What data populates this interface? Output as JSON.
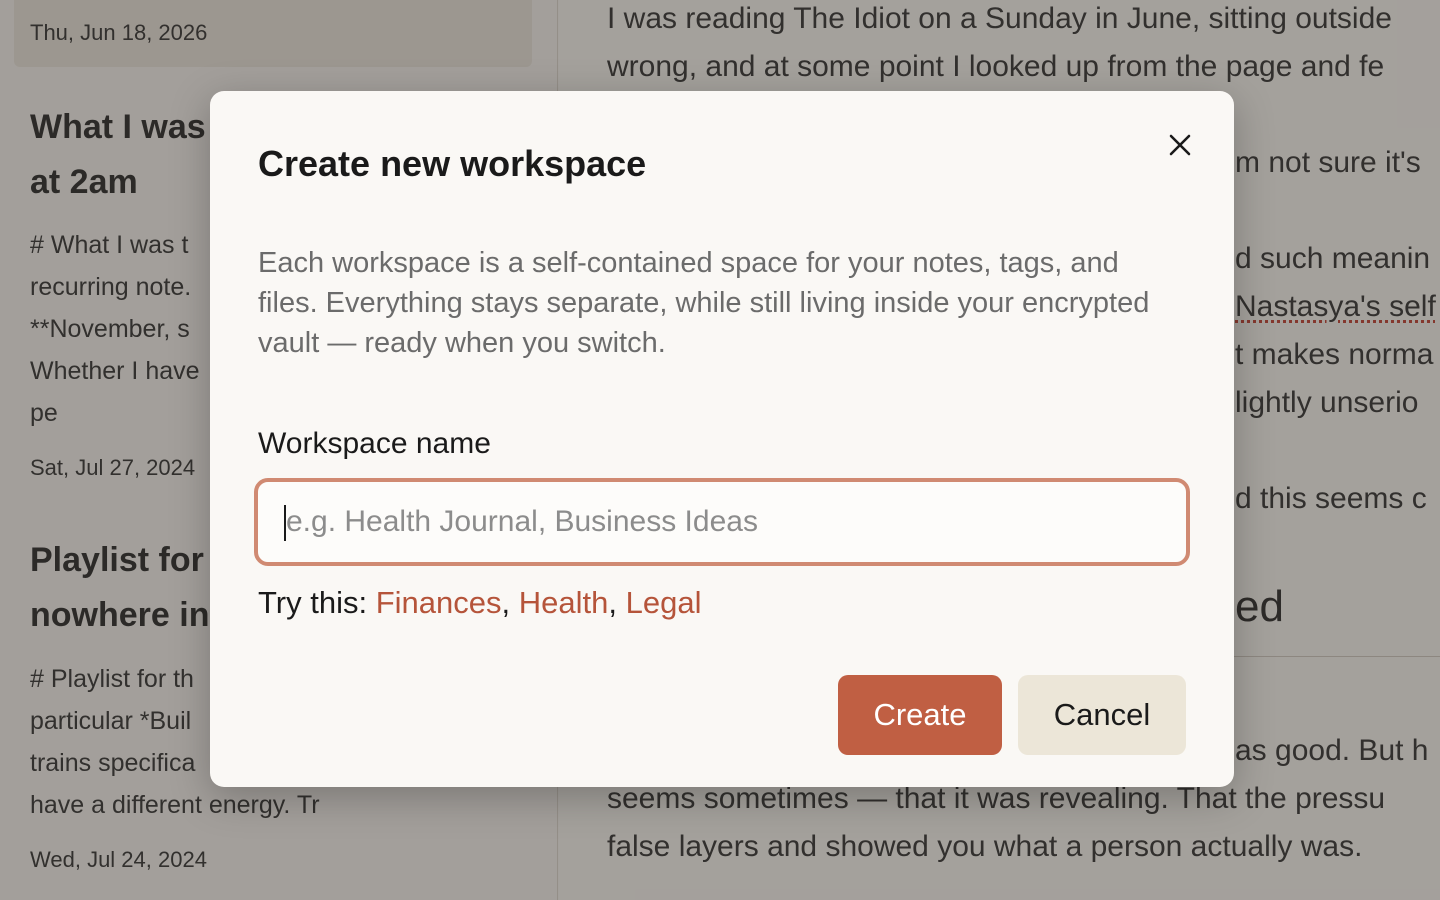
{
  "note_list": {
    "selected_date": "Thu, Jun 18, 2026",
    "notes": [
      {
        "title_lines": [
          "What I was",
          "at 2am"
        ],
        "excerpt_lines": [
          "# What I was t",
          "recurring note.",
          "**November, s",
          "Whether I have",
          "pe"
        ],
        "date": "Sat, Jul 27, 2024"
      },
      {
        "title_lines": [
          "Playlist for",
          "nowhere in"
        ],
        "excerpt_lines": [
          "# Playlist for th",
          "particular *Buil",
          "trains specifica",
          "have a different energy. Tr"
        ],
        "date": "Wed, Jul 24, 2024"
      }
    ]
  },
  "editor": {
    "lines_top": [
      "I was reading The Idiot on a Sunday in June, sitting outside",
      "wrong, and at some point I looked up from the page and fe",
      "m not sure it's",
      "d such meanin",
      "Nastasya's self",
      "t makes norma",
      "lightly unserio",
      "d this seems c"
    ],
    "heading_fragment": "ed",
    "lines_bottom": [
      "as good. But h",
      "seems sometimes — that it was revealing. That the pressu",
      "false layers and showed you what a person actually was."
    ]
  },
  "modal": {
    "title": "Create new workspace",
    "description": "Each workspace is a self-contained space for your notes, tags, and files. Everything stays separate, while still living inside your encrypted vault — ready when you switch.",
    "field_label": "Workspace name",
    "input_value": "",
    "input_placeholder": "e.g. Health Journal, Business Ideas",
    "suggestions_prefix": "Try this: ",
    "suggestions": [
      "Finances",
      "Health",
      "Legal"
    ],
    "separator": ",",
    "create_label": "Create",
    "cancel_label": "Cancel",
    "close_icon": "close-icon"
  },
  "colors": {
    "accent": "#c05f43",
    "link": "#b5543a",
    "input_focus_border": "#d08a72",
    "cancel_bg": "#ece6d8"
  }
}
